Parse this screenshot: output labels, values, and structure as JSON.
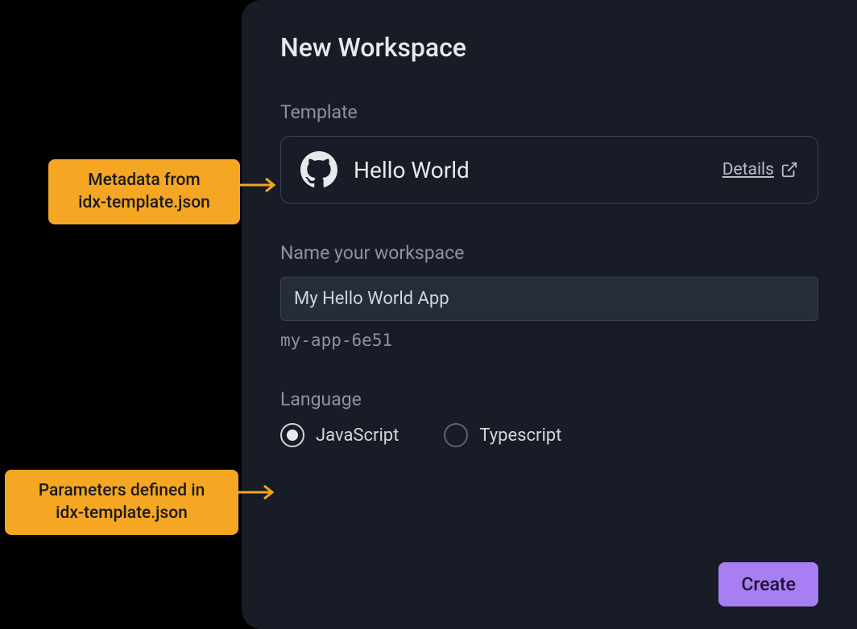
{
  "dialog": {
    "title": "New Workspace",
    "template_section_label": "Template",
    "template_name": "Hello World",
    "details_label": "Details",
    "name_section_label": "Name your workspace",
    "name_value": "My Hello World App",
    "name_slug": "my-app-6e51",
    "language_section_label": "Language",
    "language_options": [
      {
        "label": "JavaScript",
        "selected": true
      },
      {
        "label": "Typescript",
        "selected": false
      }
    ],
    "create_button": "Create"
  },
  "callouts": {
    "metadata": {
      "line1": "Metadata from",
      "line2": "idx-template.json"
    },
    "parameters": {
      "line1": "Parameters defined in",
      "line2": "idx-template.json"
    }
  },
  "icons": {
    "template": "github-icon",
    "external": "external-link-icon"
  },
  "colors": {
    "accent": "#a87ff3",
    "callout": "#f5a623",
    "dialog_bg": "#171c26"
  }
}
